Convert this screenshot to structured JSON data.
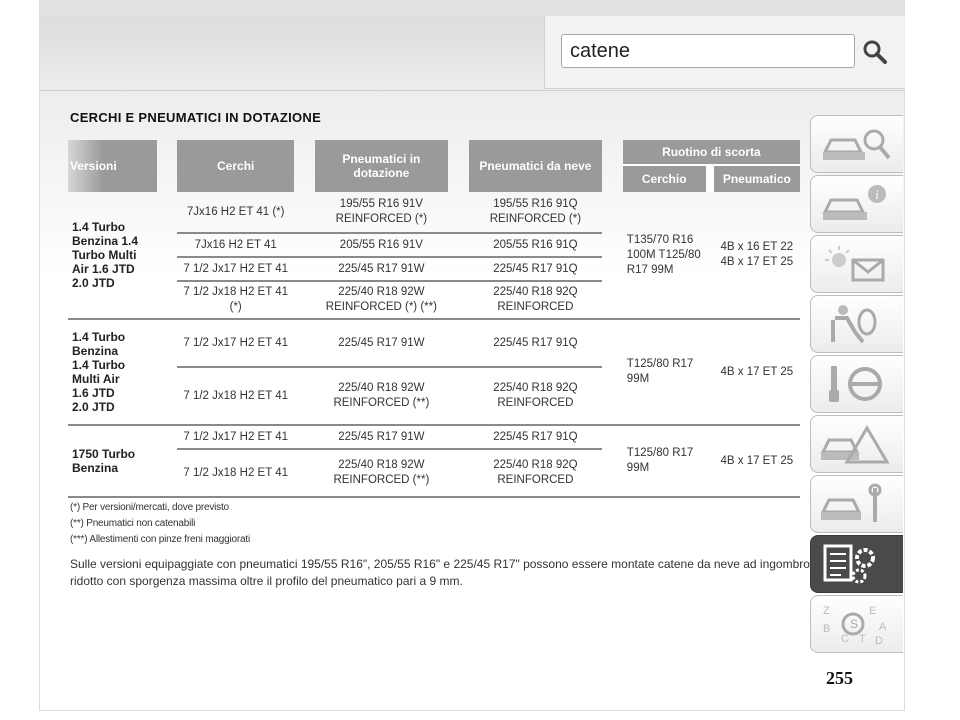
{
  "search": {
    "value": "catene"
  },
  "section_title": "CERCHI E PNEUMATICI IN DOTAZIONE",
  "table": {
    "headers": {
      "versioni": "Versioni",
      "cerchi": "Cerchi",
      "pneumatici_dotazione": "Pneumatici in dotazione",
      "pneumatici_neve": "Pneumatici da neve",
      "ruotino": "Ruotino di scorta",
      "cerchio": "Cerchio",
      "pneumatico": "Pneumatico"
    },
    "groups": [
      {
        "version": [
          "1.4 Turbo",
          "Benzina 1.4",
          "Turbo Multi",
          "Air 1.6 JTD",
          "2.0 JTD"
        ],
        "rows": [
          {
            "cerchi": "7Jx16 H2 ET 41 (*)",
            "dotazione": "195/55 R16 91V REINFORCED (*)",
            "neve": "195/55 R16 91Q REINFORCED (*)"
          },
          {
            "cerchi": "7Jx16 H2 ET 41",
            "dotazione": "205/55 R16 91V",
            "neve": "205/55 R16 91Q"
          },
          {
            "cerchi": "7 1/2 Jx17 H2 ET 41",
            "dotazione": "225/45 R17 91W",
            "neve": "225/45 R17 91Q"
          },
          {
            "cerchi": "7 1/2 Jx18 H2 ET 41 (*)",
            "dotazione": "225/40 R18 92W REINFORCED (*) (**)",
            "neve": "225/40 R18 92Q REINFORCED"
          }
        ],
        "cerchio": "T135/70 R16 100M T125/80 R17 99M",
        "pneumatico": "4B x 16 ET 22 4B x 17 ET 25"
      },
      {
        "version": [
          "1.4 Turbo",
          "Benzina",
          "1.4 Turbo",
          "Multi Air",
          "1.6 JTD",
          "2.0 JTD"
        ],
        "rows": [
          {
            "cerchi": "7 1/2 Jx17 H2 ET 41",
            "dotazione": "225/45 R17 91W",
            "neve": "225/45 R17 91Q"
          },
          {
            "cerchi": "7 1/2 Jx18 H2 ET 41",
            "dotazione": "225/40 R18 92W REINFORCED (**)",
            "neve": "225/40 R18 92Q REINFORCED"
          }
        ],
        "cerchio": "T125/80 R17 99M",
        "pneumatico": "4B x 17 ET 25"
      },
      {
        "version": [
          "1750 Turbo",
          "Benzina"
        ],
        "rows": [
          {
            "cerchi": "7 1/2 Jx17 H2 ET 41",
            "dotazione": "225/45 R17 91W",
            "neve": "225/45 R17 91Q"
          },
          {
            "cerchi": "7 1/2 Jx18 H2 ET 41",
            "dotazione": "225/40 R18 92W REINFORCED (**)",
            "neve": "225/40 R18 92Q REINFORCED"
          }
        ],
        "cerchio": "T125/80 R17 99M",
        "pneumatico": "4B x 17 ET 25"
      }
    ]
  },
  "footnotes": [
    "(*) Per versioni/mercati, dove previsto",
    "(**) Pneumatici non catenabili",
    "(***) Allestimenti con pinze freni maggiorati"
  ],
  "bottom_text": "Sulle versioni equipaggiate con pneumatici 195/55 R16\", 205/55 R16\" e 225/45 R17\" possono essere montate catene da neve ad ingombro ridotto con sporgenza massima oltre il profilo del pneumatico pari a 9 mm.",
  "page_number": "255",
  "tabs": [
    {
      "icon": "car-search-icon"
    },
    {
      "icon": "car-info-icon"
    },
    {
      "icon": "warning-lights-icon"
    },
    {
      "icon": "airbag-seat-icon"
    },
    {
      "icon": "key-steering-icon"
    },
    {
      "icon": "car-warning-icon"
    },
    {
      "icon": "car-tools-icon"
    },
    {
      "icon": "specs-gear-icon",
      "active": true
    },
    {
      "icon": "alphabet-index-icon"
    }
  ]
}
